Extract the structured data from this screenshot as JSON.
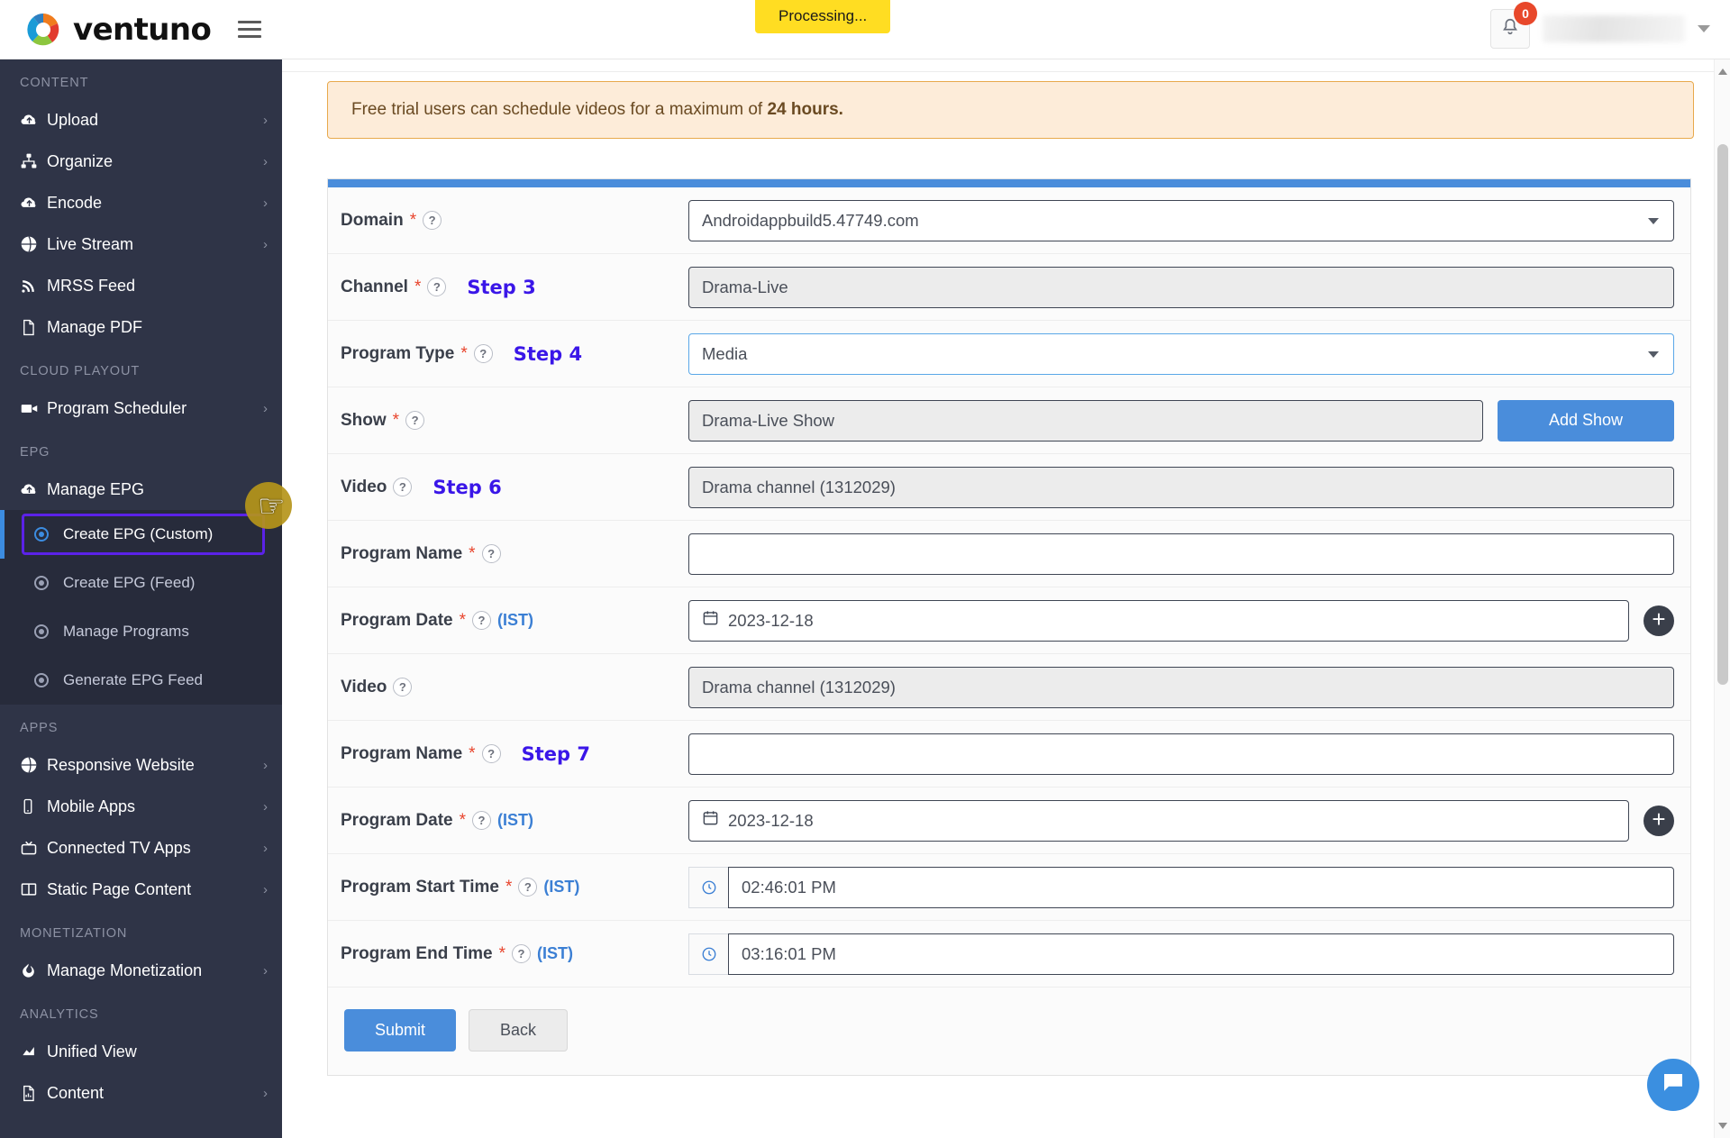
{
  "header": {
    "brand": "ventuno",
    "menu_icon": "hamburger-icon",
    "processing_label": "Processing...",
    "notification_count": "0"
  },
  "sidebar": {
    "sections": [
      {
        "title": "CONTENT",
        "items": [
          {
            "label": "Upload",
            "icon": "cloud-upload-icon",
            "chevron": "›"
          },
          {
            "label": "Organize",
            "icon": "sitemap-icon",
            "chevron": "›"
          },
          {
            "label": "Encode",
            "icon": "cloud-upload-icon",
            "chevron": "›"
          },
          {
            "label": "Live Stream",
            "icon": "globe-icon",
            "chevron": "›"
          },
          {
            "label": "MRSS Feed",
            "icon": "rss-icon",
            "chevron": ""
          },
          {
            "label": "Manage PDF",
            "icon": "pdf-file-icon",
            "chevron": ""
          }
        ]
      },
      {
        "title": "CLOUD PLAYOUT",
        "items": [
          {
            "label": "Program Scheduler",
            "icon": "video-camera-icon",
            "chevron": "›"
          }
        ]
      },
      {
        "title": "EPG",
        "items": [
          {
            "label": "Manage EPG",
            "icon": "cloud-upload-icon",
            "chevron": ""
          }
        ]
      }
    ],
    "epg_subitems": [
      {
        "label": "Create EPG (Custom)",
        "active": true
      },
      {
        "label": "Create EPG (Feed)",
        "active": false
      },
      {
        "label": "Manage Programs",
        "active": false
      },
      {
        "label": "Generate EPG Feed",
        "active": false
      }
    ],
    "apps": {
      "title": "APPS",
      "items": [
        {
          "label": "Responsive Website",
          "icon": "globe-icon",
          "chevron": "›"
        },
        {
          "label": "Mobile Apps",
          "icon": "mobile-icon",
          "chevron": "›"
        },
        {
          "label": "Connected TV Apps",
          "icon": "tv-icon",
          "chevron": "›"
        },
        {
          "label": "Static Page Content",
          "icon": "columns-icon",
          "chevron": "›"
        }
      ]
    },
    "monetization": {
      "title": "MONETIZATION",
      "items": [
        {
          "label": "Manage Monetization",
          "icon": "flame-icon",
          "chevron": "›"
        }
      ]
    },
    "analytics": {
      "title": "ANALYTICS",
      "items": [
        {
          "label": "Unified View",
          "icon": "area-chart-icon",
          "chevron": ""
        },
        {
          "label": "Content",
          "icon": "file-chart-icon",
          "chevron": "›"
        }
      ]
    }
  },
  "alert": {
    "text_before": "Free trial users can schedule videos for a maximum of ",
    "text_bold": "24 hours."
  },
  "form": {
    "rows": [
      {
        "label": "Domain",
        "required": "*",
        "help": "?",
        "step": "",
        "value": "Androidappbuild5.47749.com",
        "type": "select",
        "state": "normal"
      },
      {
        "label": "Channel",
        "required": "*",
        "help": "?",
        "step": "Step 3",
        "value": "Drama-Live",
        "type": "text",
        "state": "grey"
      },
      {
        "label": "Program Type",
        "required": "*",
        "help": "?",
        "step": "Step 4",
        "value": "Media",
        "type": "select",
        "state": "focus"
      },
      {
        "label": "Show",
        "required": "*",
        "help": "?",
        "step": "",
        "value": "Drama-Live Show",
        "type": "text",
        "state": "grey"
      },
      {
        "label": "Video",
        "required": "",
        "help": "?",
        "step": "Step 6",
        "value": "Drama channel (1312029)",
        "type": "text",
        "state": "grey"
      },
      {
        "label": "Program Name",
        "required": "*",
        "help": "?",
        "step": "",
        "value": "",
        "type": "text",
        "state": "normal"
      },
      {
        "label": "Program Date",
        "required": "*",
        "help": "?",
        "step": "",
        "ist": "(IST)",
        "value": "2023-12-18",
        "type": "date",
        "state": "normal"
      },
      {
        "label": "Video",
        "required": "",
        "help": "?",
        "step": "",
        "value": "Drama channel (1312029)",
        "type": "text",
        "state": "grey"
      },
      {
        "label": "Program Name",
        "required": "*",
        "help": "?",
        "step": "Step 7",
        "value": "",
        "type": "text",
        "state": "normal"
      },
      {
        "label": "Program Date",
        "required": "*",
        "help": "?",
        "step": "",
        "ist": "(IST)",
        "value": "2023-12-18",
        "type": "date",
        "state": "normal"
      },
      {
        "label": "Program Start Time",
        "required": "*",
        "help": "?",
        "step": "",
        "ist": "(IST)",
        "value": "02:46:01 PM",
        "type": "time",
        "state": "normal"
      },
      {
        "label": "Program End Time",
        "required": "*",
        "help": "?",
        "step": "",
        "ist": "(IST)",
        "value": "03:16:01 PM",
        "type": "time",
        "state": "normal"
      }
    ],
    "add_show_label": "Add Show",
    "submit_label": "Submit",
    "back_label": "Back",
    "plus_icon": "plus-circle-icon",
    "calendar_icon": "calendar-icon",
    "clock_icon": "clock-icon"
  },
  "colors": {
    "accent_blue": "#4a8ddb",
    "sidebar_bg": "#2f3447",
    "highlight_purple": "#5b22e8",
    "alert_bg": "#fdecd9",
    "alert_border": "#e8a94c",
    "processing_yellow": "#ffdd22",
    "badge_red": "#e8482b"
  },
  "chat": {
    "icon": "chat-bubble-icon"
  }
}
